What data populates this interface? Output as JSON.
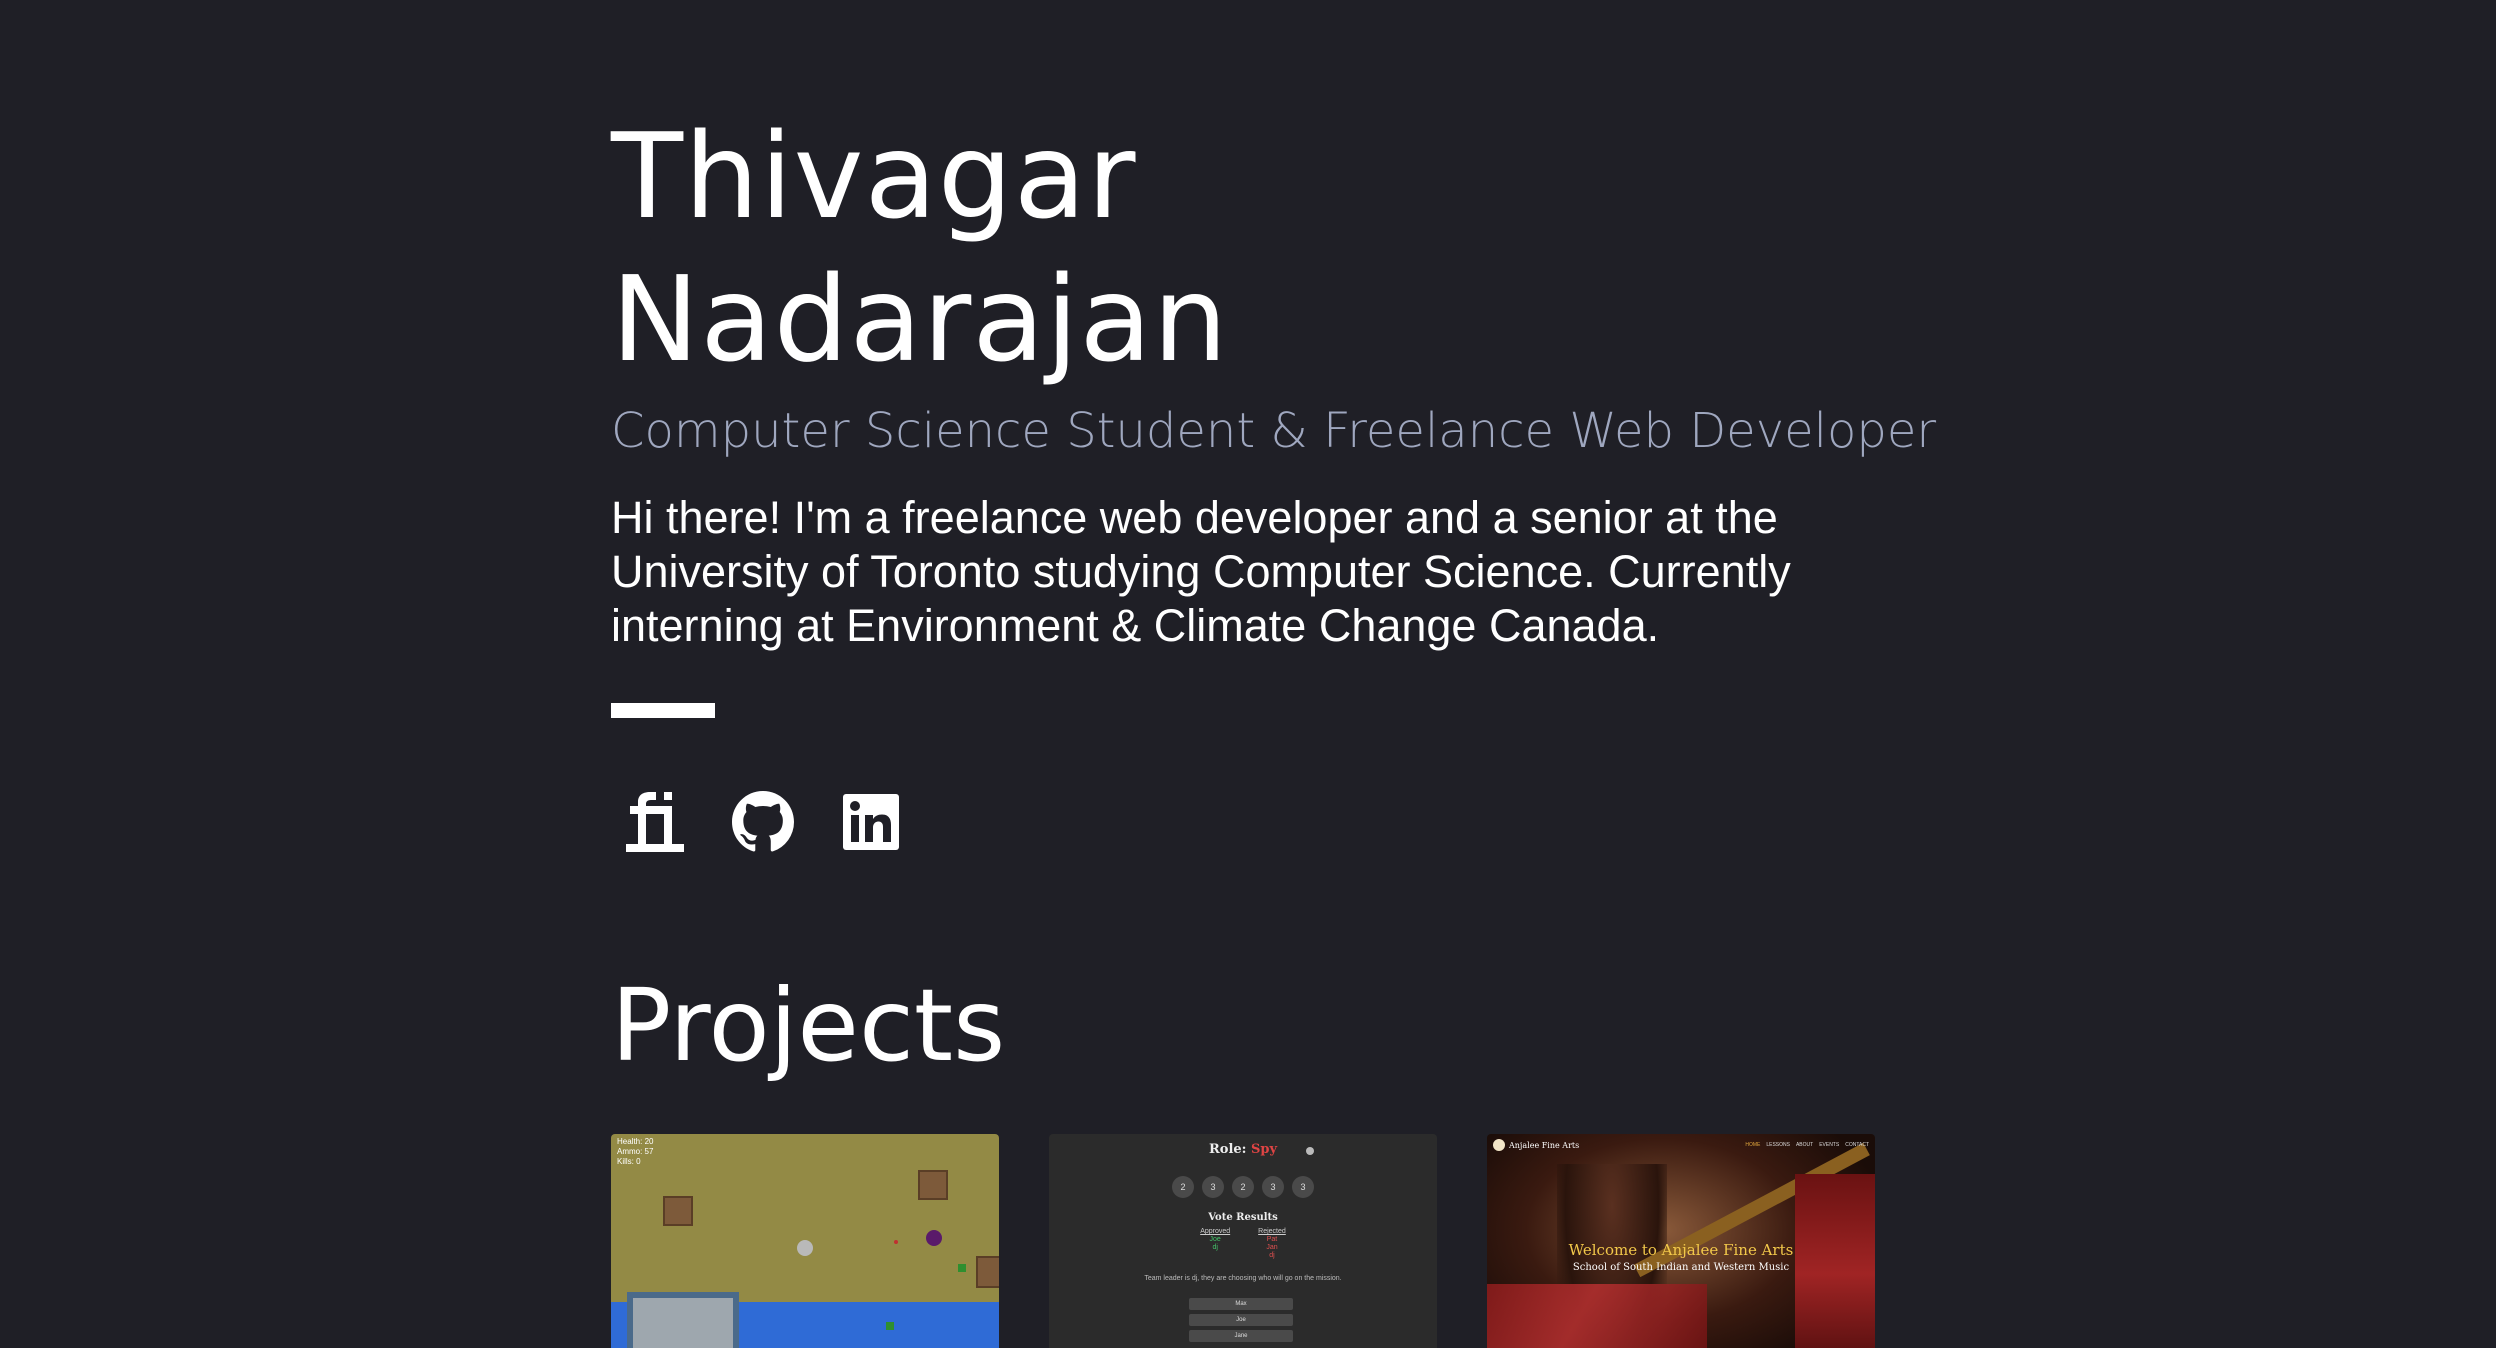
{
  "hero": {
    "name_line1": "Thivagar",
    "name_line2": "Nadarajan",
    "subtitle": "Computer Science Student & Freelance Web Developer",
    "bio": "Hi there! I'm a freelance web developer and a senior at the University of Toronto studying Computer Science. Currently interning at Environment & Climate Change Canada."
  },
  "socials": [
    {
      "name": "freelancer-icon"
    },
    {
      "name": "github-icon"
    },
    {
      "name": "linkedin-icon"
    }
  ],
  "projects": {
    "title": "Projects",
    "game": {
      "stats": [
        "Health: 20",
        "Ammo: 57",
        "Kills: 0"
      ]
    },
    "spy": {
      "role_label": "Role:",
      "role_value": "Spy",
      "rounds": [
        "2",
        "3",
        "2",
        "3",
        "3"
      ],
      "vote_title": "Vote Results",
      "approved_label": "Approved",
      "approved_values": [
        "Joe",
        "dj"
      ],
      "rejected_label": "Rejected",
      "rejected_values": [
        "Pat",
        "Jan",
        "dj"
      ],
      "message": "Team leader is dj, they are choosing who will go on the mission.",
      "players": [
        "Max",
        "Joe",
        "Jane"
      ]
    },
    "arts": {
      "brand": "Anjalee Fine Arts",
      "nav": [
        "HOME",
        "LESSONS",
        "ABOUT",
        "EVENTS",
        "CONTACT"
      ],
      "welcome": "Welcome to Anjalee Fine Arts",
      "sub": "School of South Indian and Western Music"
    }
  },
  "colors": {
    "background": "#1f1f26",
    "subtitle": "#9fa7bf",
    "text": "#ffffff"
  }
}
